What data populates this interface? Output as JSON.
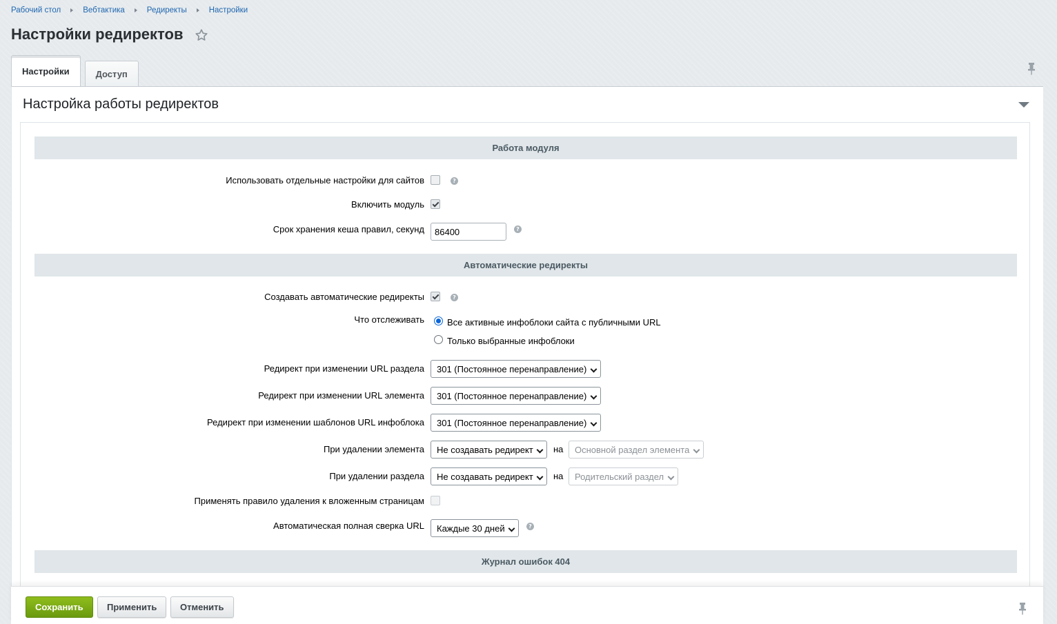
{
  "breadcrumb": [
    "Рабочий стол",
    "Вебтактика",
    "Редиректы",
    "Настройки"
  ],
  "page_title": "Настройки редиректов",
  "tabs": {
    "settings": "Настройки",
    "access": "Доступ"
  },
  "panel_title": "Настройка работы редиректов",
  "sections": {
    "module": "Работа модуля",
    "auto": "Автоматические редиректы",
    "log404": "Журнал ошибок 404"
  },
  "fields": {
    "separate_sites": {
      "label": "Использовать отдельные настройки для сайтов",
      "checked": false
    },
    "enable_module": {
      "label": "Включить модуль",
      "checked": true
    },
    "cache_ttl": {
      "label": "Срок хранения кеша правил, секунд",
      "value": "86400"
    },
    "create_auto": {
      "label": "Создавать автоматические редиректы",
      "checked": true
    },
    "track": {
      "label": "Что отслеживать",
      "option_all": "Все активные инфоблоки сайта с публичными URL",
      "option_selected": "Только выбранные инфоблоки",
      "selected": "option_all"
    },
    "section_url": {
      "label": "Редирект при изменении URL раздела",
      "value": "301 (Постоянное перенаправление)"
    },
    "element_url": {
      "label": "Редирект при изменении URL элемента",
      "value": "301 (Постоянное перенаправление)"
    },
    "iblock_tpl": {
      "label": "Редирект при изменении шаблонов URL инфоблока",
      "value": "301 (Постоянное перенаправление)"
    },
    "del_element": {
      "label": "При удалении элемента",
      "value": "Не создавать редирект",
      "na": "на",
      "target": "Основной раздел элемента"
    },
    "del_section": {
      "label": "При удалении раздела",
      "value": "Не создавать редирект",
      "na": "на",
      "target": "Родительский раздел"
    },
    "apply_nested": {
      "label": "Применять правило удаления к вложенным страницам",
      "checked": false,
      "disabled": true
    },
    "full_check": {
      "label": "Автоматическая полная сверка URL",
      "value": "Каждые 30 дней"
    }
  },
  "help_glyph": "?",
  "footer": {
    "save": "Сохранить",
    "apply": "Применить",
    "cancel": "Отменить"
  },
  "colors": {
    "save_button": "#7aaa13",
    "link": "#2067b0",
    "section_band": "#e0e6e9"
  }
}
